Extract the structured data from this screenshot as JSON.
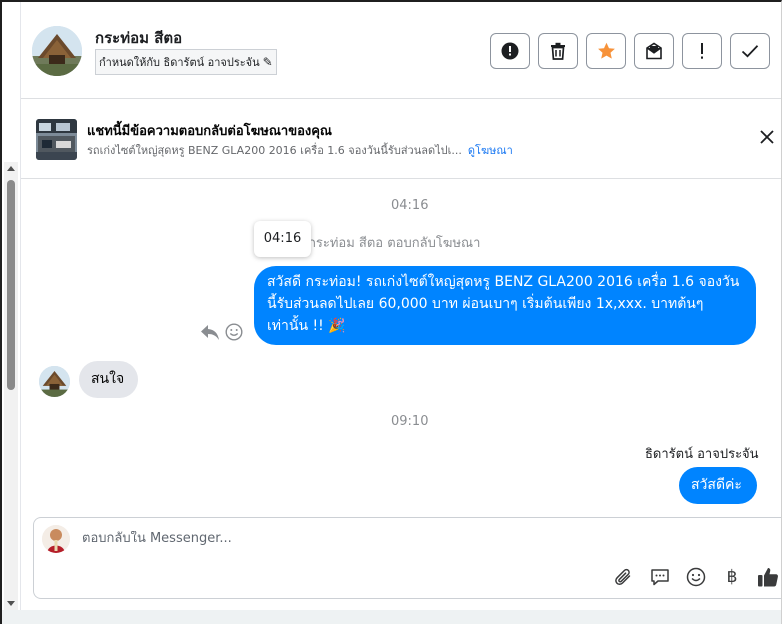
{
  "header": {
    "contact_name": "กระท่อม สีตอ",
    "assign_label": "กำหนดให้กับ ธิดารัตน์ อาจประจัน",
    "toolbar": [
      {
        "name": "spam-button",
        "icon": "alert-circle-icon"
      },
      {
        "name": "delete-button",
        "icon": "trash-icon"
      },
      {
        "name": "star-button",
        "icon": "star-icon"
      },
      {
        "name": "mark-unread-button",
        "icon": "envelope-icon"
      },
      {
        "name": "follow-up-button",
        "icon": "exclamation-icon"
      },
      {
        "name": "mark-done-button",
        "icon": "check-icon"
      }
    ]
  },
  "ad_banner": {
    "title": "แชทนี้มีข้อความตอบกลับต่อโฆษณาของคุณ",
    "ad_text": "รถเก่งไซต์ใหญ่สุดหรู BENZ GLA200 2016 เครื่อ 1.6 จองวันนี้รับส่วนลดไปเ...",
    "view_ad_link": "ดูโฆษณา"
  },
  "messages": {
    "time_1": "04:16",
    "tooltip_time": "04:16",
    "ad_reply_note": "กระท่อม สีตอ ตอบกลับโฆษณา",
    "outgoing_1": "สวัสดี กระท่อม! รถเก่งไซต์ใหญ่สุดหรู BENZ GLA200 2016 เครื่อ 1.6 จองวันนี้รับส่วนลดไปเลย 60,000 บาท ผ่อนเบาๆ เริ่มต้นเพียง 1x,xxx. บาทต้นๆ เท่านั้น !! 🎉",
    "incoming_1": "สนใจ",
    "time_2": "09:10",
    "sender_name": "ธิดารัตน์ อาจประจัน",
    "outgoing_2": "สวัสดีค่ะ"
  },
  "composer": {
    "placeholder": "ตอบกลับใน Messenger...",
    "baht_symbol": "฿"
  },
  "colors": {
    "accent": "#0084ff",
    "link": "#1877f2",
    "star": "#f7923a"
  }
}
